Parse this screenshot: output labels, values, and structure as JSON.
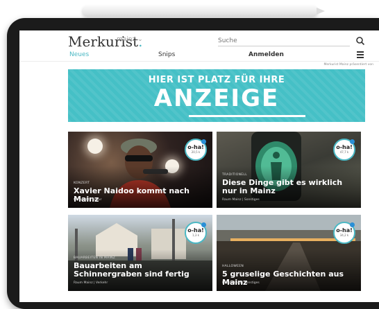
{
  "header": {
    "logo": "Merkurist",
    "logo_dot": ".",
    "city": "mainz",
    "search_placeholder": "Suche",
    "tagline": "Merkurist Mainz präsentiert von"
  },
  "nav": {
    "active": "Neues",
    "snips": "Snips",
    "login": "Anmelden"
  },
  "ad": {
    "line1": "HIER IST PLATZ FÜR IHRE",
    "line2": "ANZEIGE"
  },
  "cards": [
    {
      "kicker": "KONZERT",
      "title": "Xavier Naidoo kommt nach Mainz",
      "meta": "Citruslicht | Kultur",
      "badge": "o-ha!",
      "badge_sub": "20,5 k"
    },
    {
      "kicker": "TRADITIONELL",
      "title": "Diese Dinge gibt es wirklich nur in Mainz",
      "meta": "Raum Mainz | Sonstiges",
      "badge": "o-ha!",
      "badge_sub": "47,7 k"
    },
    {
      "kicker": "BAUARBEITEN IN MAINZ",
      "title": "Bauarbeiten am Schinnergraben sind fertig",
      "meta": "Raum Mainz | Verkehr",
      "badge": "o-ha!",
      "badge_sub": "1,3 k"
    },
    {
      "kicker": "HALLOWEEN",
      "title": "5 gruselige Geschichten aus Mainz",
      "meta": "Raum Mainz | Sonstiges",
      "badge": "o-ha!",
      "badge_sub": "34,2 k"
    }
  ],
  "colors": {
    "accent": "#4bb8c4",
    "ad_background": "#45c0c6",
    "badge_dot": "#2a8fd6"
  }
}
